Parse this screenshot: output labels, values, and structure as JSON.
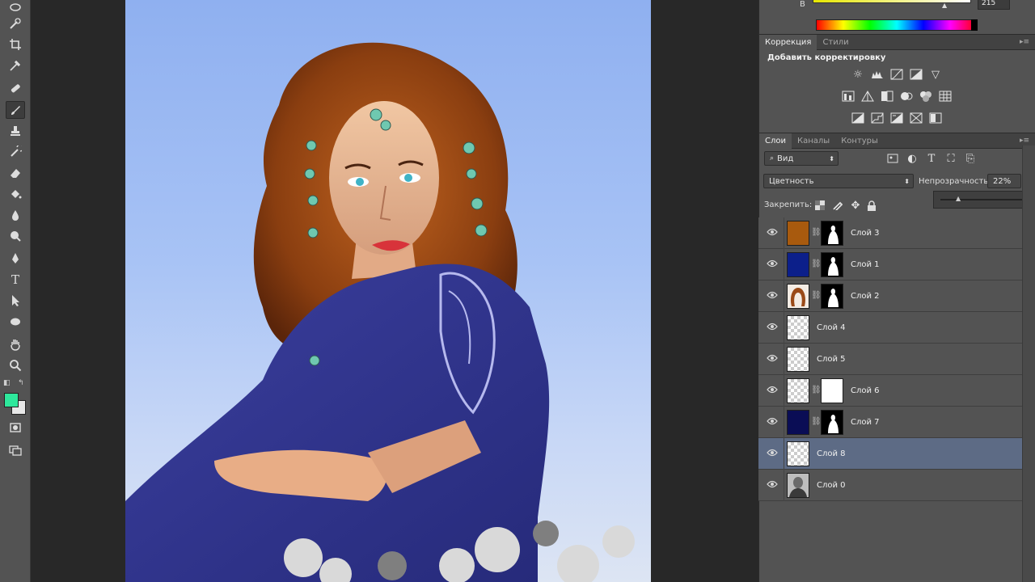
{
  "color_panel": {
    "channel_label": "B",
    "channel_value": "215"
  },
  "adjustments_panel": {
    "tabs": [
      "Коррекция",
      "Стили"
    ],
    "heading": "Добавить корректировку",
    "icons_row1": [
      "brightness-icon",
      "levels-icon",
      "curves-icon",
      "exposure-icon",
      "vibrance-icon"
    ],
    "icons_row2": [
      "hue-saturation-icon",
      "color-balance-icon",
      "black-white-icon",
      "photo-filter-icon",
      "channel-mixer-icon",
      "color-lookup-icon"
    ],
    "icons_row3": [
      "invert-icon",
      "posterize-icon",
      "threshold-icon",
      "selective-color-icon",
      "gradient-map-icon"
    ]
  },
  "layers_panel": {
    "tabs": [
      "Слои",
      "Каналы",
      "Контуры"
    ],
    "filter_label": "Вид",
    "blend_mode": "Цветность",
    "opacity_label": "Непрозрачность:",
    "opacity_value": "22%",
    "lock_label": "Закрепить:",
    "layers": [
      {
        "name": "Слой 3",
        "color": "#a85a0e",
        "has_mask": true,
        "selected": false
      },
      {
        "name": "Слой 1",
        "color": "#0c1f8a",
        "has_mask": true,
        "selected": false
      },
      {
        "name": "Слой 2",
        "color": "hair",
        "has_mask": true,
        "selected": false
      },
      {
        "name": "Слой 4",
        "color": "checker",
        "has_mask": false,
        "selected": false
      },
      {
        "name": "Слой 5",
        "color": "checker",
        "has_mask": false,
        "selected": false
      },
      {
        "name": "Слой 6",
        "color": "checker",
        "has_mask": true,
        "selected": false
      },
      {
        "name": "Слой 7",
        "color": "#0a0d55",
        "has_mask": true,
        "selected": false
      },
      {
        "name": "Слой 8",
        "color": "checker",
        "has_mask": false,
        "selected": true
      },
      {
        "name": "Слой 0",
        "color": "photo",
        "has_mask": false,
        "selected": false
      }
    ]
  },
  "tools": {
    "foreground_color": "#2ee89c",
    "background_color": "#e8e8e8"
  }
}
